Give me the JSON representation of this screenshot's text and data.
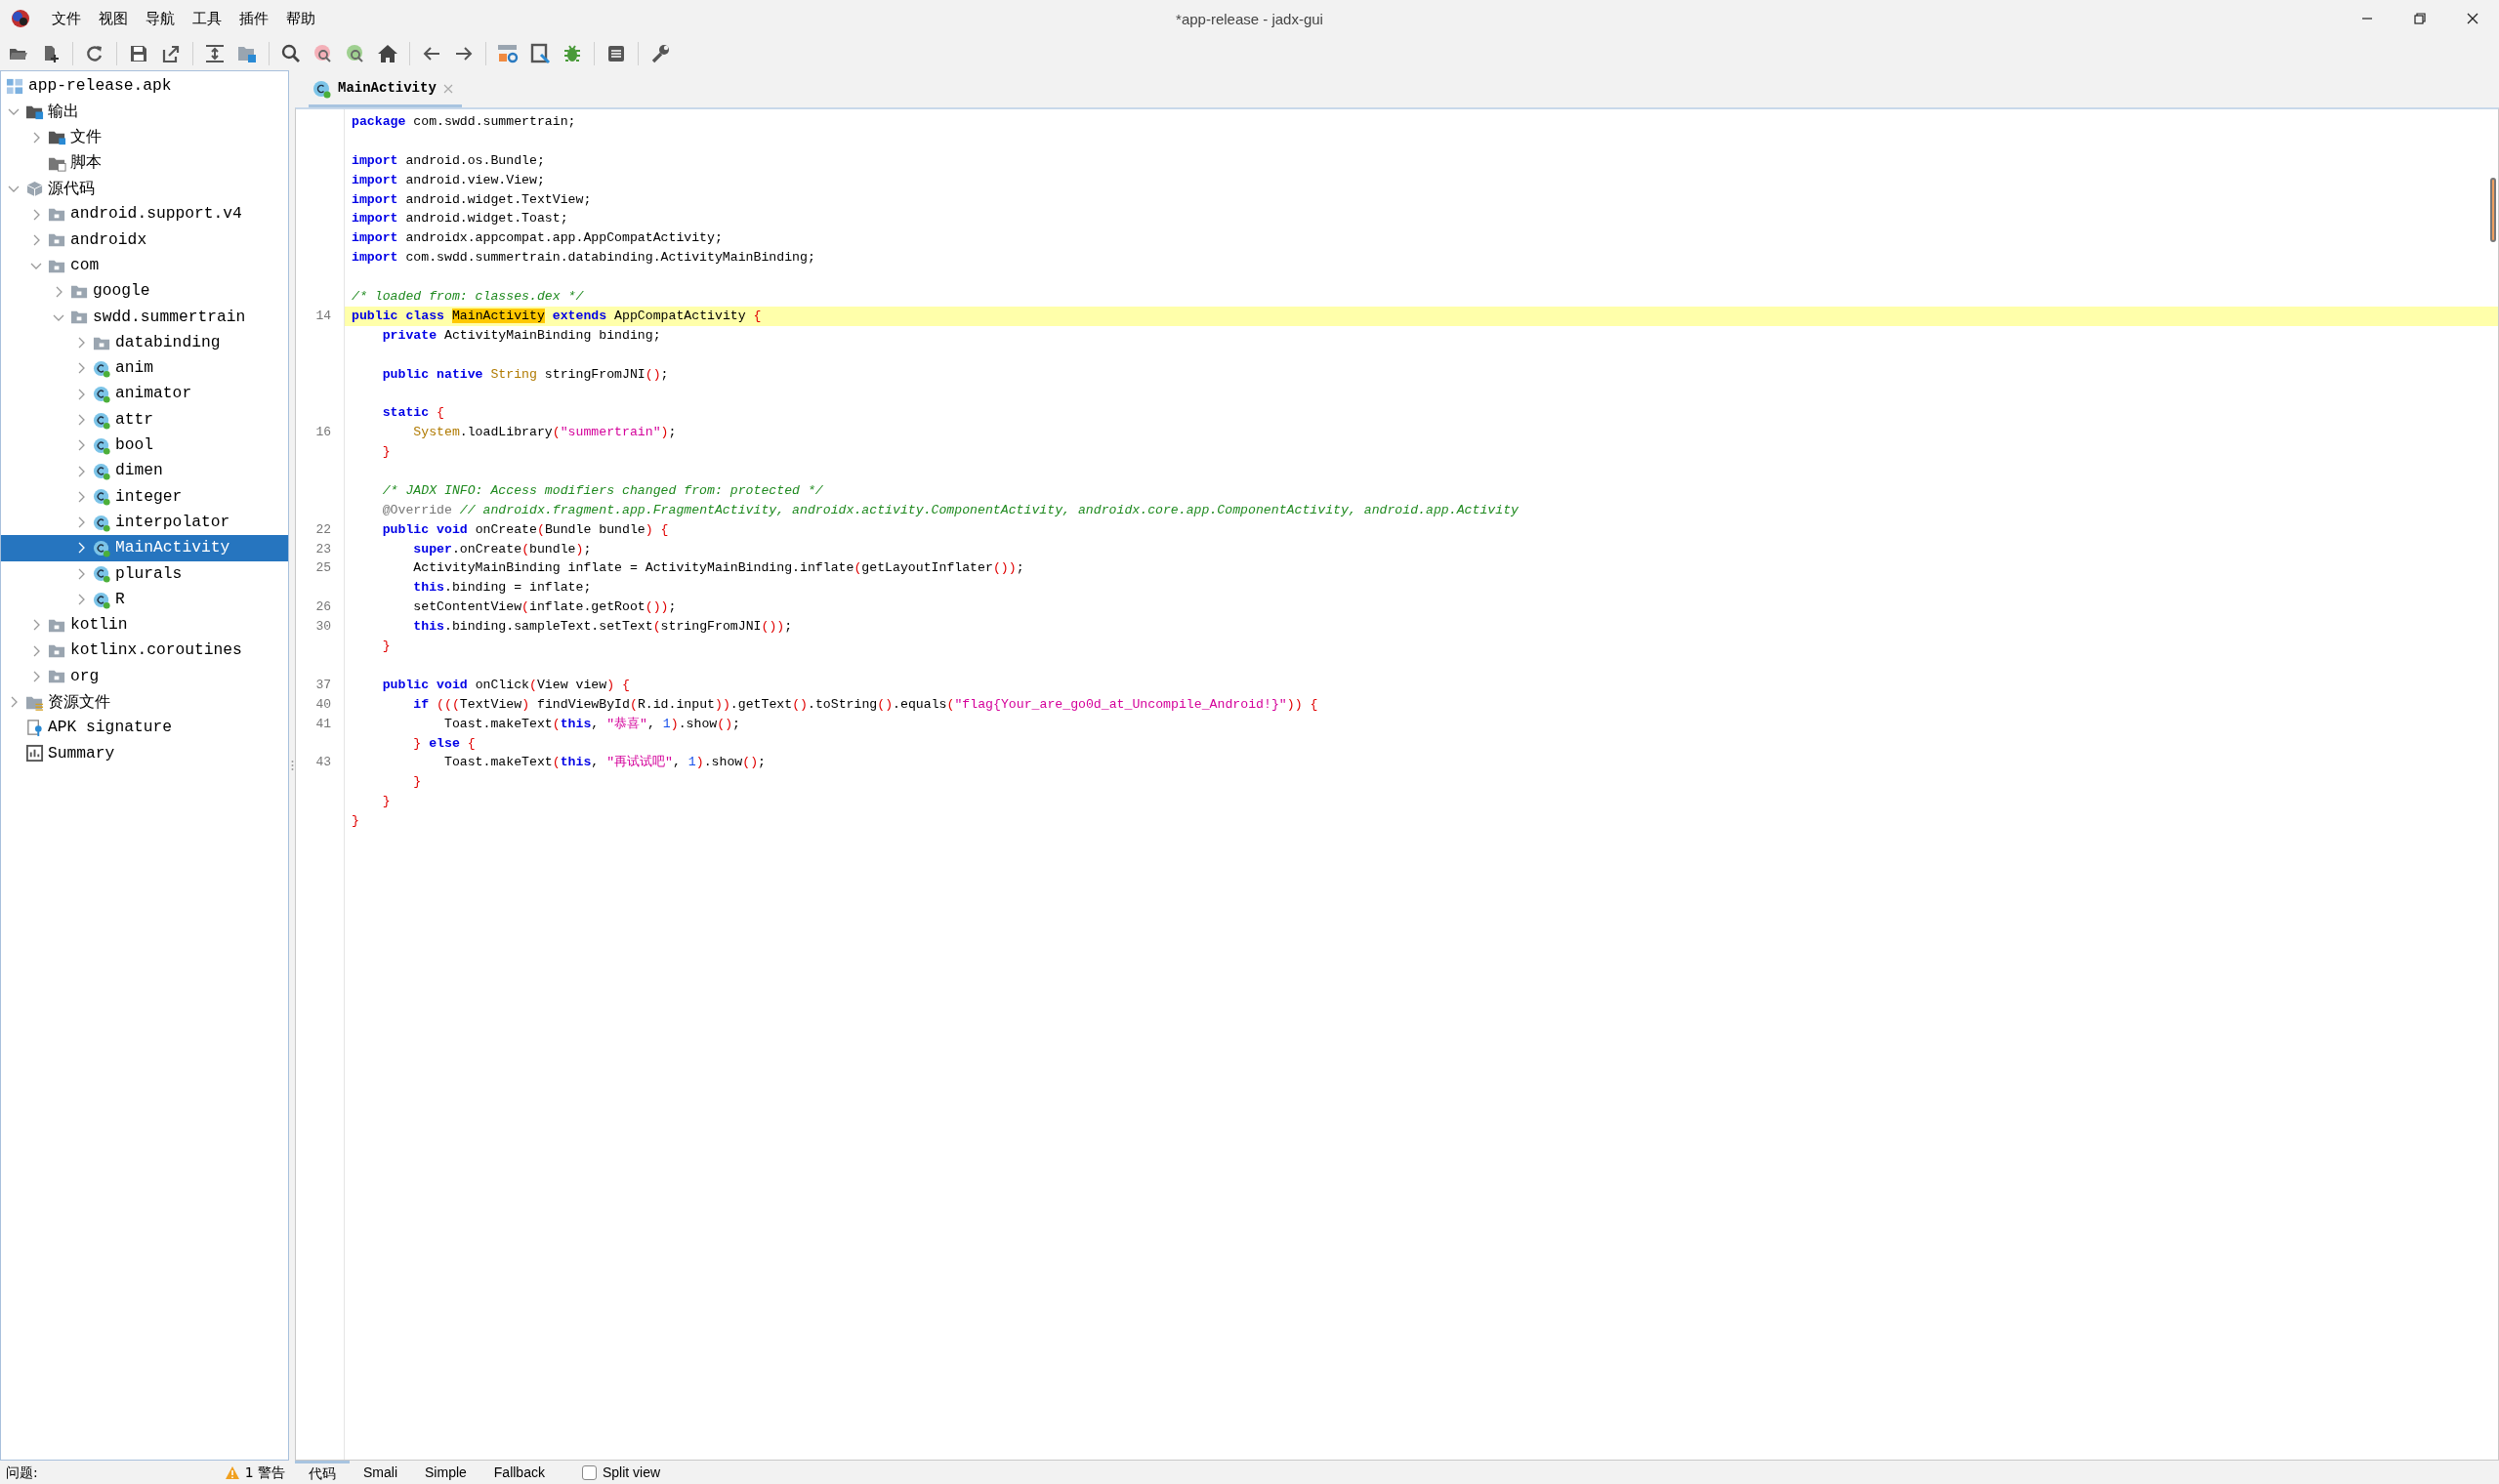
{
  "window": {
    "title": "*app-release - jadx-gui"
  },
  "menu": [
    "文件",
    "视图",
    "导航",
    "工具",
    "插件",
    "帮助"
  ],
  "tree": {
    "label": "app-release.apk",
    "kind": "apk",
    "selected": false,
    "children": [
      {
        "label": "输出",
        "kind": "output",
        "expanded": true,
        "selected": false,
        "children": [
          {
            "label": "文件",
            "kind": "output-files",
            "expanded": false,
            "selected": false
          },
          {
            "label": "脚本",
            "kind": "script",
            "selected": false
          }
        ]
      },
      {
        "label": "源代码",
        "kind": "sources",
        "expanded": true,
        "selected": false,
        "children": [
          {
            "label": "android.support.v4",
            "kind": "package",
            "expanded": false,
            "selected": false
          },
          {
            "label": "androidx",
            "kind": "package",
            "expanded": false,
            "selected": false
          },
          {
            "label": "com",
            "kind": "package",
            "expanded": true,
            "selected": false,
            "children": [
              {
                "label": "google",
                "kind": "package",
                "expanded": false,
                "selected": false
              },
              {
                "label": "swdd.summertrain",
                "kind": "package",
                "expanded": true,
                "selected": false,
                "children": [
                  {
                    "label": "databinding",
                    "kind": "package",
                    "expanded": false,
                    "selected": false
                  },
                  {
                    "label": "anim",
                    "kind": "class",
                    "expanded": false,
                    "selected": false
                  },
                  {
                    "label": "animator",
                    "kind": "class",
                    "expanded": false,
                    "selected": false
                  },
                  {
                    "label": "attr",
                    "kind": "class",
                    "expanded": false,
                    "selected": false
                  },
                  {
                    "label": "bool",
                    "kind": "class",
                    "expanded": false,
                    "selected": false
                  },
                  {
                    "label": "dimen",
                    "kind": "class",
                    "expanded": false,
                    "selected": false
                  },
                  {
                    "label": "integer",
                    "kind": "class",
                    "expanded": false,
                    "selected": false
                  },
                  {
                    "label": "interpolator",
                    "kind": "class",
                    "expanded": false,
                    "selected": false
                  },
                  {
                    "label": "MainActivity",
                    "kind": "class",
                    "expanded": false,
                    "selected": true
                  },
                  {
                    "label": "plurals",
                    "kind": "class",
                    "expanded": false,
                    "selected": false
                  },
                  {
                    "label": "R",
                    "kind": "class",
                    "expanded": false,
                    "selected": false
                  }
                ]
              }
            ]
          },
          {
            "label": "kotlin",
            "kind": "package",
            "expanded": false,
            "selected": false
          },
          {
            "label": "kotlinx.coroutines",
            "kind": "package",
            "expanded": false,
            "selected": false
          },
          {
            "label": "org",
            "kind": "package",
            "expanded": false,
            "selected": false
          }
        ]
      },
      {
        "label": "资源文件",
        "kind": "resources",
        "expanded": false,
        "selected": false
      },
      {
        "label": "APK signature",
        "kind": "signature",
        "selected": false
      },
      {
        "label": "Summary",
        "kind": "summary",
        "selected": false
      }
    ]
  },
  "editor": {
    "tab": {
      "label": "MainActivity",
      "kind": "class",
      "selected": true
    },
    "lines": [
      {
        "kind": "code",
        "current": false,
        "tokens": [
          {
            "kind": "keyword",
            "text": "package"
          },
          {
            "kind": "plain",
            "text": " com.swdd.summertrain;"
          }
        ]
      },
      {
        "kind": "blank"
      },
      {
        "kind": "code",
        "current": false,
        "tokens": [
          {
            "kind": "keyword",
            "text": "import"
          },
          {
            "kind": "plain",
            "text": " android.os.Bundle;"
          }
        ]
      },
      {
        "kind": "code",
        "current": false,
        "tokens": [
          {
            "kind": "keyword",
            "text": "import"
          },
          {
            "kind": "plain",
            "text": " android.view.View;"
          }
        ]
      },
      {
        "kind": "code",
        "current": false,
        "tokens": [
          {
            "kind": "keyword",
            "text": "import"
          },
          {
            "kind": "plain",
            "text": " android.widget.TextView;"
          }
        ]
      },
      {
        "kind": "code",
        "current": false,
        "tokens": [
          {
            "kind": "keyword",
            "text": "import"
          },
          {
            "kind": "plain",
            "text": " android.widget.Toast;"
          }
        ]
      },
      {
        "kind": "code",
        "current": false,
        "tokens": [
          {
            "kind": "keyword",
            "text": "import"
          },
          {
            "kind": "plain",
            "text": " androidx.appcompat.app.AppCompatActivity;"
          }
        ]
      },
      {
        "kind": "code",
        "current": false,
        "tokens": [
          {
            "kind": "keyword",
            "text": "import"
          },
          {
            "kind": "plain",
            "text": " com.swdd.summertrain.databinding.ActivityMainBinding;"
          }
        ]
      },
      {
        "kind": "blank"
      },
      {
        "kind": "code",
        "current": false,
        "tokens": [
          {
            "kind": "comment",
            "text": "/* loaded from: classes.dex */"
          }
        ]
      },
      {
        "kind": "code",
        "current": true,
        "line_number": "14",
        "tokens": [
          {
            "kind": "keyword",
            "text": "public class "
          },
          {
            "kind": "match",
            "text": "MainActivity"
          },
          {
            "kind": "keyword",
            "text": " extends"
          },
          {
            "kind": "plain",
            "text": " AppCompatActivity {"
          }
        ]
      },
      {
        "kind": "code",
        "current": false,
        "tokens": [
          {
            "kind": "keyword",
            "text": "    private"
          },
          {
            "kind": "plain",
            "text": " ActivityMainBinding binding;"
          }
        ]
      },
      {
        "kind": "blank"
      },
      {
        "kind": "code",
        "current": false,
        "tokens": [
          {
            "kind": "keyword",
            "text": "    public native "
          },
          {
            "kind": "type",
            "text": "String"
          },
          {
            "kind": "plain",
            "text": " stringFromJNI();"
          }
        ]
      },
      {
        "kind": "blank"
      },
      {
        "kind": "code",
        "current": false,
        "tokens": [
          {
            "kind": "keyword",
            "text": "    static"
          },
          {
            "kind": "plain",
            "text": " {"
          }
        ]
      },
      {
        "kind": "code",
        "current": false,
        "line_number": "16",
        "tokens": [
          {
            "kind": "type",
            "text": "        System"
          },
          {
            "kind": "plain",
            "text": ".loadLibrary("
          },
          {
            "kind": "string",
            "text": "\"summertrain\""
          },
          {
            "kind": "plain",
            "text": ");"
          }
        ]
      },
      {
        "kind": "code",
        "current": false,
        "tokens": [
          {
            "kind": "plain",
            "text": "    }"
          }
        ]
      },
      {
        "kind": "blank"
      },
      {
        "kind": "code",
        "current": false,
        "tokens": [
          {
            "kind": "comment",
            "text": "    /* JADX INFO: Access modifiers changed from: protected */"
          }
        ]
      },
      {
        "kind": "code",
        "current": false,
        "tokens": [
          {
            "kind": "annotation",
            "text": "    @Override"
          },
          {
            "kind": "comment",
            "text": " // androidx.fragment.app.FragmentActivity, androidx.activity.ComponentActivity, androidx.core.app.ComponentActivity, android.app.Activity"
          }
        ]
      },
      {
        "kind": "code",
        "current": false,
        "line_number": "22",
        "tokens": [
          {
            "kind": "keyword",
            "text": "    public void"
          },
          {
            "kind": "plain",
            "text": " onCreate(Bundle bundle) {"
          }
        ]
      },
      {
        "kind": "code",
        "current": false,
        "line_number": "23",
        "tokens": [
          {
            "kind": "keyword",
            "text": "        super"
          },
          {
            "kind": "plain",
            "text": ".onCreate(bundle);"
          }
        ]
      },
      {
        "kind": "code",
        "current": false,
        "line_number": "25",
        "tokens": [
          {
            "kind": "plain",
            "text": "        ActivityMainBinding inflate = ActivityMainBinding.inflate(getLayoutInflater());"
          }
        ]
      },
      {
        "kind": "code",
        "current": false,
        "tokens": [
          {
            "kind": "keyword",
            "text": "        this"
          },
          {
            "kind": "plain",
            "text": ".binding = inflate;"
          }
        ]
      },
      {
        "kind": "code",
        "current": false,
        "line_number": "26",
        "tokens": [
          {
            "kind": "plain",
            "text": "        setContentView(inflate.getRoot());"
          }
        ]
      },
      {
        "kind": "code",
        "current": false,
        "line_number": "30",
        "tokens": [
          {
            "kind": "keyword",
            "text": "        this"
          },
          {
            "kind": "plain",
            "text": ".binding.sampleText.setText(stringFromJNI());"
          }
        ]
      },
      {
        "kind": "code",
        "current": false,
        "tokens": [
          {
            "kind": "plain",
            "text": "    }"
          }
        ]
      },
      {
        "kind": "blank"
      },
      {
        "kind": "code",
        "current": false,
        "line_number": "37",
        "tokens": [
          {
            "kind": "keyword",
            "text": "    public void"
          },
          {
            "kind": "plain",
            "text": " onClick(View view) {"
          }
        ]
      },
      {
        "kind": "code",
        "current": false,
        "line_number": "40",
        "tokens": [
          {
            "kind": "keyword",
            "text": "        if"
          },
          {
            "kind": "plain",
            "text": " (((TextView) findViewById(R.id.input)).getText().toString().equals("
          },
          {
            "kind": "string",
            "text": "\"flag{Your_are_go0d_at_Uncompile_Android!}\""
          },
          {
            "kind": "plain",
            "text": ")) {"
          }
        ]
      },
      {
        "kind": "code",
        "current": false,
        "line_number": "41",
        "tokens": [
          {
            "kind": "plain",
            "text": "            Toast.makeText("
          },
          {
            "kind": "keyword",
            "text": "this"
          },
          {
            "kind": "plain",
            "text": ", "
          },
          {
            "kind": "string",
            "text": "\"恭喜\""
          },
          {
            "kind": "plain",
            "text": ", "
          },
          {
            "kind": "number",
            "text": "1"
          },
          {
            "kind": "plain",
            "text": ").show();"
          }
        ]
      },
      {
        "kind": "code",
        "current": false,
        "tokens": [
          {
            "kind": "plain",
            "text": "        } "
          },
          {
            "kind": "keyword",
            "text": "else"
          },
          {
            "kind": "plain",
            "text": " {"
          }
        ]
      },
      {
        "kind": "code",
        "current": false,
        "line_number": "43",
        "tokens": [
          {
            "kind": "plain",
            "text": "            Toast.makeText("
          },
          {
            "kind": "keyword",
            "text": "this"
          },
          {
            "kind": "plain",
            "text": ", "
          },
          {
            "kind": "string",
            "text": "\"再试试吧\""
          },
          {
            "kind": "plain",
            "text": ", "
          },
          {
            "kind": "number",
            "text": "1"
          },
          {
            "kind": "plain",
            "text": ").show();"
          }
        ]
      },
      {
        "kind": "code",
        "current": false,
        "tokens": [
          {
            "kind": "plain",
            "text": "        }"
          }
        ]
      },
      {
        "kind": "code",
        "current": false,
        "tokens": [
          {
            "kind": "plain",
            "text": "    }"
          }
        ]
      },
      {
        "kind": "code",
        "current": false,
        "tokens": [
          {
            "kind": "plain",
            "text": "}"
          }
        ]
      }
    ]
  },
  "status": {
    "label": "问题:",
    "warnings": "1 警告"
  },
  "bottom_tabs": [
    {
      "label": "代码",
      "selected": true
    },
    {
      "label": "Smali",
      "selected": false
    },
    {
      "label": "Simple",
      "selected": false
    },
    {
      "label": "Fallback",
      "selected": false
    }
  ],
  "split_view": {
    "label": "Split view",
    "checked": false
  }
}
